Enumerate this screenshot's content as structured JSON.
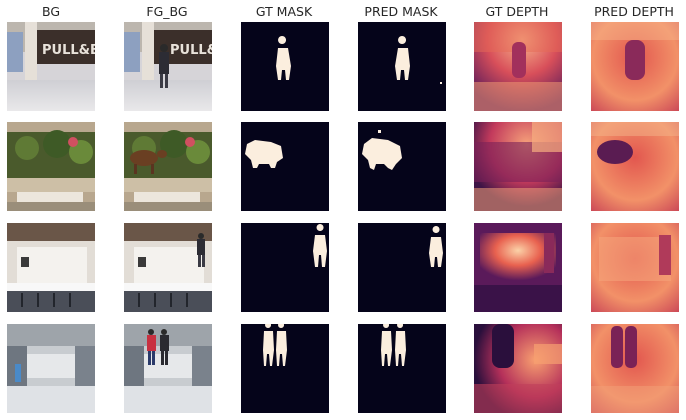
{
  "columns": {
    "bg": "BG",
    "fg_bg": "FG_BG",
    "gt_mask": "GT MASK",
    "pred_mask": "PRED MASK",
    "gt_depth": "GT DEPTH",
    "pred_depth": "PRED DEPTH"
  },
  "colors": {
    "mask_background": "#05041a",
    "mask_foreground": "#fbeede",
    "depth_dark": "#2a0f3c",
    "depth_mid": "#b8365a",
    "depth_bright": "#f9b68b",
    "page_background": "#ffffff"
  },
  "rows": [
    {
      "scene": "mall storefront",
      "storefront_text": "PULL&BEA"
    },
    {
      "scene": "plant wall with cow"
    },
    {
      "scene": "bright office lobby"
    },
    {
      "scene": "shopping mall corridor"
    }
  ]
}
